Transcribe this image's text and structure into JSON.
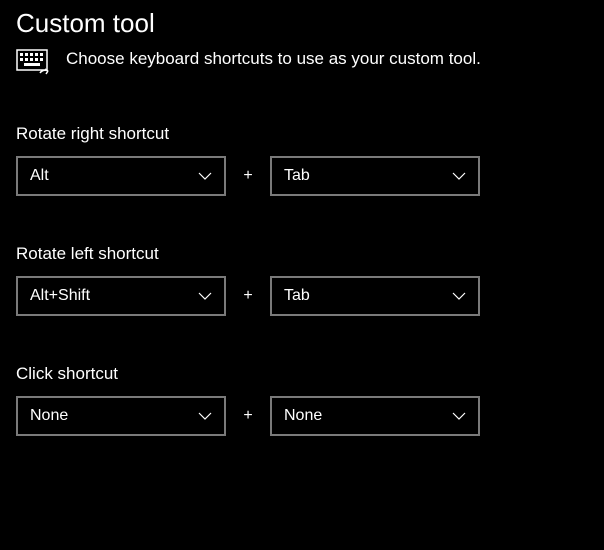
{
  "header": {
    "title": "Custom tool",
    "description": "Choose keyboard shortcuts to use as your custom tool."
  },
  "shortcuts": {
    "rotate_right": {
      "label": "Rotate right shortcut",
      "modifier": "Alt",
      "key": "Tab"
    },
    "rotate_left": {
      "label": "Rotate left shortcut",
      "modifier": "Alt+Shift",
      "key": "Tab"
    },
    "click": {
      "label": "Click shortcut",
      "modifier": "None",
      "key": "None"
    }
  },
  "ui": {
    "plus": "+"
  }
}
